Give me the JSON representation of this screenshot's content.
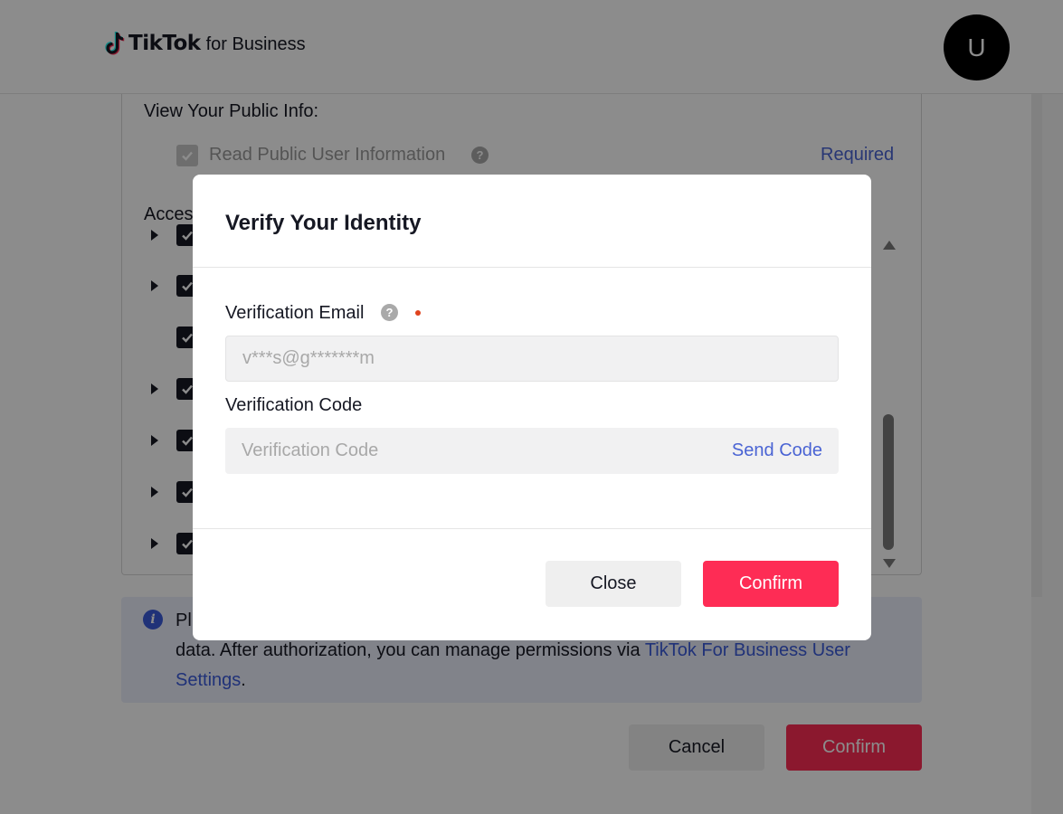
{
  "header": {
    "logo_brand": "TikTok",
    "logo_sub": "for Business",
    "avatar_initial": "U"
  },
  "permissions": {
    "public_info_title": "View Your Public Info:",
    "public_info_item": "Read Public User Information",
    "required_label": "Required",
    "access_title": "Access"
  },
  "notice": {
    "text_start": "Pl",
    "text_line2": "data. After authorization, you can manage permissions via ",
    "link_text": "TikTok For Business User Settings",
    "text_end": "."
  },
  "page_buttons": {
    "cancel": "Cancel",
    "confirm": "Confirm"
  },
  "modal": {
    "title": "Verify Your Identity",
    "email_label": "Verification Email",
    "email_placeholder": "v***s@g*******m",
    "code_label": "Verification Code",
    "code_placeholder": "Verification Code",
    "send_code": "Send Code",
    "close_button": "Close",
    "confirm_button": "Confirm"
  },
  "colors": {
    "brand": "#fe2c55",
    "link": "#4a64d4",
    "required_dot": "#e0431d"
  }
}
